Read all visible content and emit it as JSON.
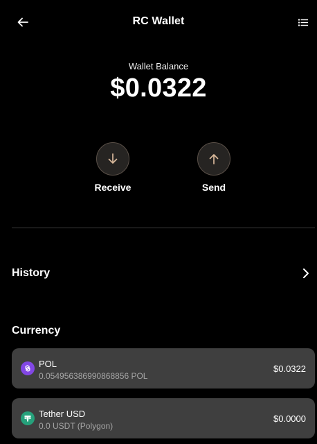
{
  "header": {
    "title": "RC Wallet",
    "back_icon": "arrow-left-icon",
    "menu_icon": "list-icon"
  },
  "balance": {
    "label": "Wallet Balance",
    "value": "$0.0322"
  },
  "actions": [
    {
      "label": "Receive",
      "icon": "arrow-down-icon"
    },
    {
      "label": "Send",
      "icon": "arrow-up-icon"
    }
  ],
  "history": {
    "label": "History",
    "icon": "chevron-right-icon"
  },
  "currency": {
    "heading": "Currency",
    "items": [
      {
        "name": "POL",
        "amount": "0.054956386990868856 POL",
        "value": "$0.0322",
        "icon": "polygon-icon",
        "icon_color": "#8247e5"
      },
      {
        "name": "Tether USD",
        "amount": "0.0 USDT (Polygon)",
        "value": "$0.0000",
        "icon": "tether-icon",
        "icon_color": "#26a17b"
      }
    ]
  },
  "colors": {
    "background": "#000000",
    "card": "#3f3f3f",
    "action_circle": "#262422",
    "action_icon": "#d9b99b"
  }
}
